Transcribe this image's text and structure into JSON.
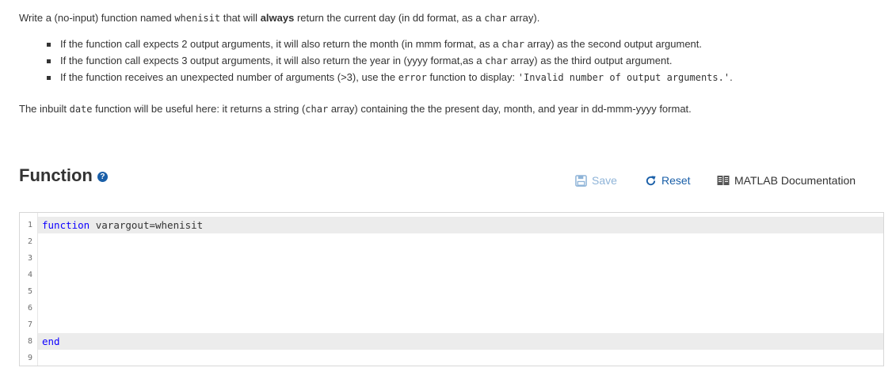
{
  "problem": {
    "p1": {
      "t1": "Write a (no-input) function named ",
      "fname": "whenisit",
      "t2": " that will ",
      "strong": "always",
      "t3": " return the current day (in dd format, as a ",
      "char": "char",
      "t4": " array)."
    },
    "bullets": [
      {
        "a": "If the function call expects 2 output arguments, it will also return the month (in mmm format, as a ",
        "code": "char",
        "b": " array) as the second output argument."
      },
      {
        "a": "If the function call expects 3 output arguments, it will also return the year in (yyyy format,as a ",
        "code": "char",
        "b": " array) as the third output argument."
      },
      {
        "a": "If the function receives an unexpected number of arguments (>3), use the ",
        "code": "error",
        "b": " function to display: ",
        "code2": "'Invalid number of output arguments.'",
        "c": "."
      }
    ],
    "p2": {
      "t1": "The inbuilt ",
      "code1": "date",
      "t2": " function will be useful here: it returns a string (",
      "code2": "char",
      "t3": " array) containing the the present day, month, and year in dd-mmm-yyyy format."
    }
  },
  "section": {
    "title": "Function",
    "help_icon": "question-circle-icon"
  },
  "toolbar": {
    "save_label": "Save",
    "reset_label": "Reset",
    "doc_label": "MATLAB Documentation",
    "save_color": "#8fb4d8",
    "reset_color": "#1a5fa8"
  },
  "editor": {
    "lines": [
      {
        "num": "1",
        "kw": "function",
        "rest": " varargout=whenisit"
      },
      {
        "num": "2",
        "kw": "",
        "rest": ""
      },
      {
        "num": "3",
        "kw": "",
        "rest": ""
      },
      {
        "num": "4",
        "kw": "",
        "rest": ""
      },
      {
        "num": "5",
        "kw": "",
        "rest": ""
      },
      {
        "num": "6",
        "kw": "",
        "rest": ""
      },
      {
        "num": "7",
        "kw": "",
        "rest": ""
      },
      {
        "num": "8",
        "kw": "end",
        "rest": ""
      },
      {
        "num": "9",
        "kw": "",
        "rest": ""
      }
    ],
    "keyword_color": "#0e00ff"
  }
}
